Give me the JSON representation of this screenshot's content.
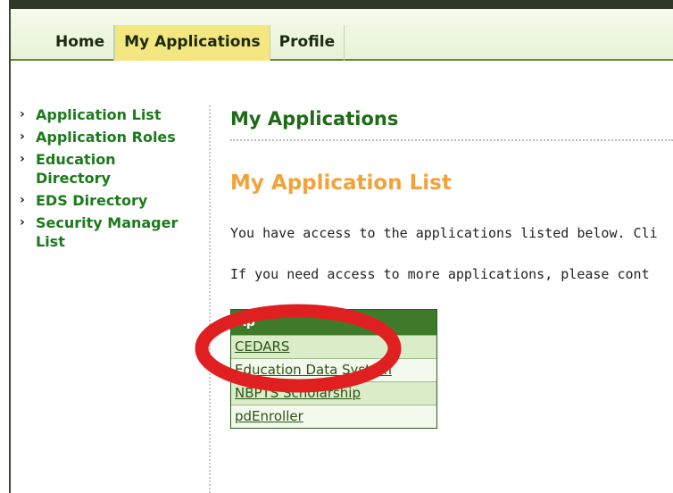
{
  "nav": {
    "tabs": [
      {
        "label": "Home"
      },
      {
        "label": "My Applications"
      },
      {
        "label": "Profile"
      }
    ]
  },
  "sidebar": {
    "items": [
      {
        "label": "Application List"
      },
      {
        "label": "Application Roles"
      },
      {
        "label": "Education Directory"
      },
      {
        "label": "EDS Directory"
      },
      {
        "label": "Security Manager List"
      }
    ]
  },
  "main": {
    "title": "My Applications",
    "subtitle": "My Application List",
    "para1": "You have access to the applications listed below. Cli",
    "para2": "If you need access to more applications, please cont"
  },
  "table": {
    "header": "Ap",
    "rows": [
      {
        "label": "CEDARS"
      },
      {
        "label": "Education Data System"
      },
      {
        "label": "NBPTS Scholarship"
      },
      {
        "label": "pdEnroller"
      }
    ]
  },
  "colors": {
    "annotation": "#e02020",
    "accent_green": "#1e6a17",
    "accent_orange": "#f2a23a",
    "tab_active": "#f4e680"
  }
}
